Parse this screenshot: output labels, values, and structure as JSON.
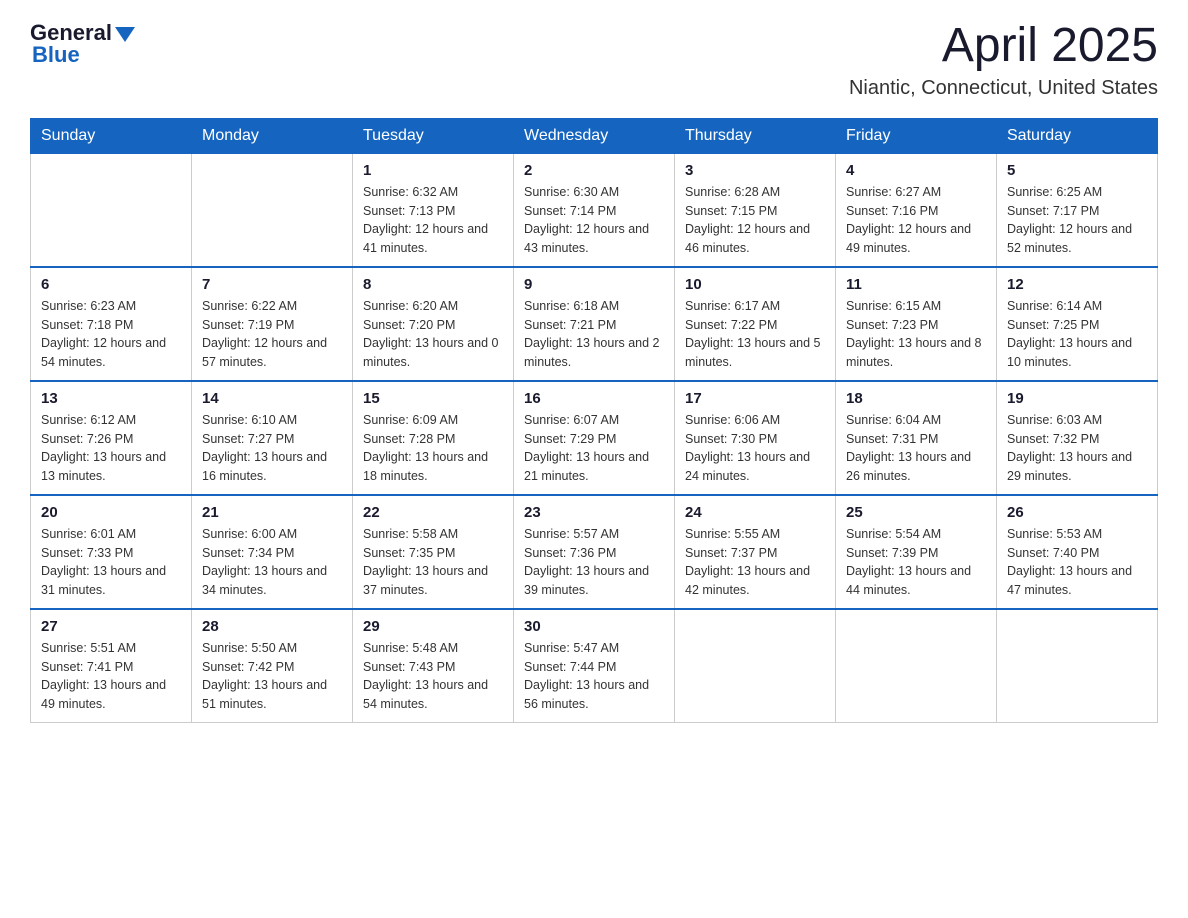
{
  "header": {
    "logo_general": "General",
    "logo_blue": "Blue",
    "month_title": "April 2025",
    "location": "Niantic, Connecticut, United States"
  },
  "weekdays": [
    "Sunday",
    "Monday",
    "Tuesday",
    "Wednesday",
    "Thursday",
    "Friday",
    "Saturday"
  ],
  "weeks": [
    [
      {
        "day": "",
        "sunrise": "",
        "sunset": "",
        "daylight": ""
      },
      {
        "day": "",
        "sunrise": "",
        "sunset": "",
        "daylight": ""
      },
      {
        "day": "1",
        "sunrise": "Sunrise: 6:32 AM",
        "sunset": "Sunset: 7:13 PM",
        "daylight": "Daylight: 12 hours and 41 minutes."
      },
      {
        "day": "2",
        "sunrise": "Sunrise: 6:30 AM",
        "sunset": "Sunset: 7:14 PM",
        "daylight": "Daylight: 12 hours and 43 minutes."
      },
      {
        "day": "3",
        "sunrise": "Sunrise: 6:28 AM",
        "sunset": "Sunset: 7:15 PM",
        "daylight": "Daylight: 12 hours and 46 minutes."
      },
      {
        "day": "4",
        "sunrise": "Sunrise: 6:27 AM",
        "sunset": "Sunset: 7:16 PM",
        "daylight": "Daylight: 12 hours and 49 minutes."
      },
      {
        "day": "5",
        "sunrise": "Sunrise: 6:25 AM",
        "sunset": "Sunset: 7:17 PM",
        "daylight": "Daylight: 12 hours and 52 minutes."
      }
    ],
    [
      {
        "day": "6",
        "sunrise": "Sunrise: 6:23 AM",
        "sunset": "Sunset: 7:18 PM",
        "daylight": "Daylight: 12 hours and 54 minutes."
      },
      {
        "day": "7",
        "sunrise": "Sunrise: 6:22 AM",
        "sunset": "Sunset: 7:19 PM",
        "daylight": "Daylight: 12 hours and 57 minutes."
      },
      {
        "day": "8",
        "sunrise": "Sunrise: 6:20 AM",
        "sunset": "Sunset: 7:20 PM",
        "daylight": "Daylight: 13 hours and 0 minutes."
      },
      {
        "day": "9",
        "sunrise": "Sunrise: 6:18 AM",
        "sunset": "Sunset: 7:21 PM",
        "daylight": "Daylight: 13 hours and 2 minutes."
      },
      {
        "day": "10",
        "sunrise": "Sunrise: 6:17 AM",
        "sunset": "Sunset: 7:22 PM",
        "daylight": "Daylight: 13 hours and 5 minutes."
      },
      {
        "day": "11",
        "sunrise": "Sunrise: 6:15 AM",
        "sunset": "Sunset: 7:23 PM",
        "daylight": "Daylight: 13 hours and 8 minutes."
      },
      {
        "day": "12",
        "sunrise": "Sunrise: 6:14 AM",
        "sunset": "Sunset: 7:25 PM",
        "daylight": "Daylight: 13 hours and 10 minutes."
      }
    ],
    [
      {
        "day": "13",
        "sunrise": "Sunrise: 6:12 AM",
        "sunset": "Sunset: 7:26 PM",
        "daylight": "Daylight: 13 hours and 13 minutes."
      },
      {
        "day": "14",
        "sunrise": "Sunrise: 6:10 AM",
        "sunset": "Sunset: 7:27 PM",
        "daylight": "Daylight: 13 hours and 16 minutes."
      },
      {
        "day": "15",
        "sunrise": "Sunrise: 6:09 AM",
        "sunset": "Sunset: 7:28 PM",
        "daylight": "Daylight: 13 hours and 18 minutes."
      },
      {
        "day": "16",
        "sunrise": "Sunrise: 6:07 AM",
        "sunset": "Sunset: 7:29 PM",
        "daylight": "Daylight: 13 hours and 21 minutes."
      },
      {
        "day": "17",
        "sunrise": "Sunrise: 6:06 AM",
        "sunset": "Sunset: 7:30 PM",
        "daylight": "Daylight: 13 hours and 24 minutes."
      },
      {
        "day": "18",
        "sunrise": "Sunrise: 6:04 AM",
        "sunset": "Sunset: 7:31 PM",
        "daylight": "Daylight: 13 hours and 26 minutes."
      },
      {
        "day": "19",
        "sunrise": "Sunrise: 6:03 AM",
        "sunset": "Sunset: 7:32 PM",
        "daylight": "Daylight: 13 hours and 29 minutes."
      }
    ],
    [
      {
        "day": "20",
        "sunrise": "Sunrise: 6:01 AM",
        "sunset": "Sunset: 7:33 PM",
        "daylight": "Daylight: 13 hours and 31 minutes."
      },
      {
        "day": "21",
        "sunrise": "Sunrise: 6:00 AM",
        "sunset": "Sunset: 7:34 PM",
        "daylight": "Daylight: 13 hours and 34 minutes."
      },
      {
        "day": "22",
        "sunrise": "Sunrise: 5:58 AM",
        "sunset": "Sunset: 7:35 PM",
        "daylight": "Daylight: 13 hours and 37 minutes."
      },
      {
        "day": "23",
        "sunrise": "Sunrise: 5:57 AM",
        "sunset": "Sunset: 7:36 PM",
        "daylight": "Daylight: 13 hours and 39 minutes."
      },
      {
        "day": "24",
        "sunrise": "Sunrise: 5:55 AM",
        "sunset": "Sunset: 7:37 PM",
        "daylight": "Daylight: 13 hours and 42 minutes."
      },
      {
        "day": "25",
        "sunrise": "Sunrise: 5:54 AM",
        "sunset": "Sunset: 7:39 PM",
        "daylight": "Daylight: 13 hours and 44 minutes."
      },
      {
        "day": "26",
        "sunrise": "Sunrise: 5:53 AM",
        "sunset": "Sunset: 7:40 PM",
        "daylight": "Daylight: 13 hours and 47 minutes."
      }
    ],
    [
      {
        "day": "27",
        "sunrise": "Sunrise: 5:51 AM",
        "sunset": "Sunset: 7:41 PM",
        "daylight": "Daylight: 13 hours and 49 minutes."
      },
      {
        "day": "28",
        "sunrise": "Sunrise: 5:50 AM",
        "sunset": "Sunset: 7:42 PM",
        "daylight": "Daylight: 13 hours and 51 minutes."
      },
      {
        "day": "29",
        "sunrise": "Sunrise: 5:48 AM",
        "sunset": "Sunset: 7:43 PM",
        "daylight": "Daylight: 13 hours and 54 minutes."
      },
      {
        "day": "30",
        "sunrise": "Sunrise: 5:47 AM",
        "sunset": "Sunset: 7:44 PM",
        "daylight": "Daylight: 13 hours and 56 minutes."
      },
      {
        "day": "",
        "sunrise": "",
        "sunset": "",
        "daylight": ""
      },
      {
        "day": "",
        "sunrise": "",
        "sunset": "",
        "daylight": ""
      },
      {
        "day": "",
        "sunrise": "",
        "sunset": "",
        "daylight": ""
      }
    ]
  ]
}
